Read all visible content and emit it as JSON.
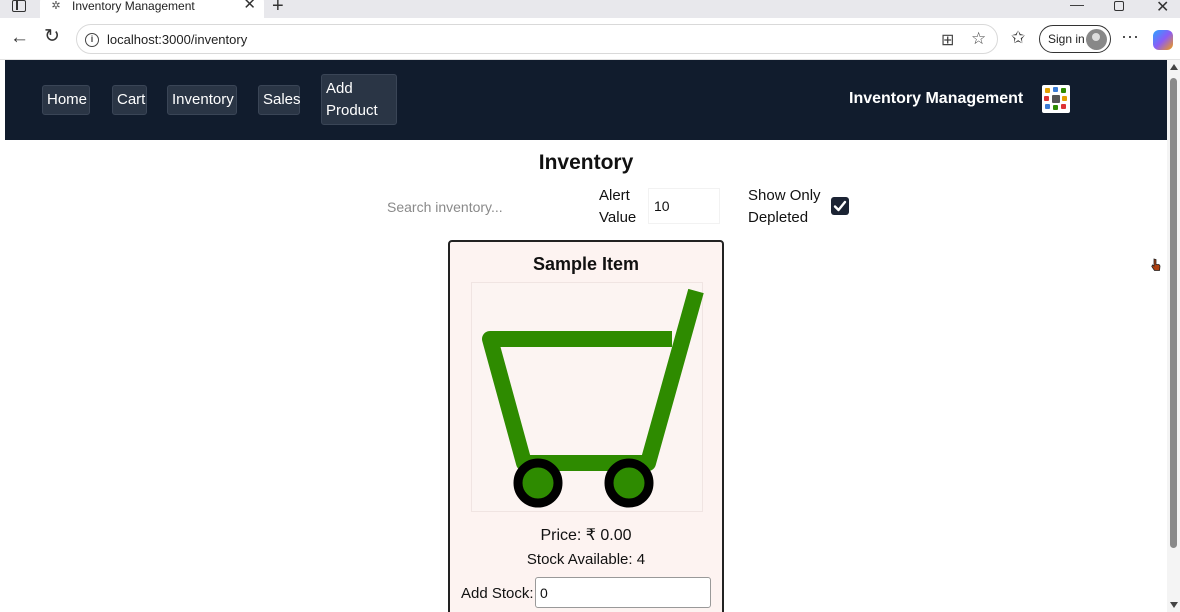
{
  "browser": {
    "tab_title": "Inventory Management",
    "url": "localhost:3000/inventory",
    "signin_label": "Sign in"
  },
  "navbar": {
    "links": [
      "Home",
      "Cart",
      "Inventory",
      "Sales",
      "Add Product"
    ],
    "brand": "Inventory Management"
  },
  "page": {
    "title": "Inventory",
    "search_placeholder": "Search inventory...",
    "alert_label": "Alert Value",
    "alert_value": "10",
    "show_depleted_label": "Show Only Depleted",
    "show_depleted_checked": true
  },
  "item": {
    "name": "Sample Item",
    "price": "Price: ₹ 0.00",
    "stock": "Stock Available: 4",
    "add_stock_label": "Add Stock:",
    "add_stock_value": "0",
    "image_icon": "shopping-cart-icon",
    "cart_color": "#2e8b00",
    "wheel_color": "#000000"
  },
  "colors": {
    "navbar_bg": "#111c2d",
    "nav_button_bg": "#2a3545",
    "card_bg": "#fdf3f1"
  }
}
